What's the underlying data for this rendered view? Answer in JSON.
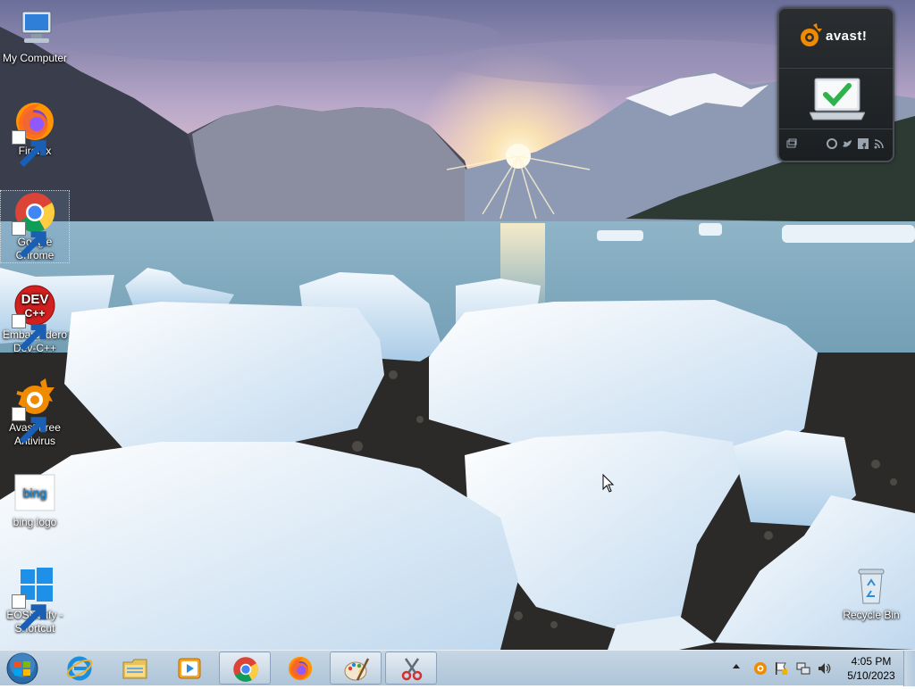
{
  "desktop": {
    "icons": [
      {
        "label": "My Computer",
        "icon": "computer-icon"
      },
      {
        "label": "Firefox",
        "icon": "firefox-icon"
      },
      {
        "label": "Google Chrome",
        "icon": "chrome-icon"
      },
      {
        "label": "Embarcadero Dev-C++",
        "icon": "devcpp-icon"
      },
      {
        "label": "Avast Free Antivirus",
        "icon": "avast-icon"
      },
      {
        "label": "bing logo",
        "icon": "bing-icon"
      },
      {
        "label": "EOSNotify - Shortcut",
        "icon": "windows-icon"
      },
      {
        "label": "Recycle Bin",
        "icon": "recycle-bin-icon"
      }
    ],
    "devcpp_badge_top": "DEV",
    "devcpp_badge_bottom": "C++",
    "bing_logo_text": "bing"
  },
  "gadget": {
    "brand": "avast!",
    "status_icon": "laptop-check-icon",
    "footer_icons": [
      "window-icon",
      "globe-icon",
      "twitter-icon",
      "facebook-icon",
      "rss-icon"
    ]
  },
  "taskbar": {
    "start_icon": "windows-start-orb",
    "items": [
      {
        "icon": "internet-explorer-icon",
        "open": false
      },
      {
        "icon": "file-explorer-icon",
        "open": false
      },
      {
        "icon": "media-player-icon",
        "open": false
      },
      {
        "icon": "chrome-icon",
        "open": true
      },
      {
        "icon": "firefox-icon",
        "open": false
      },
      {
        "icon": "paint-icon",
        "open": true
      },
      {
        "icon": "snipping-tool-icon",
        "open": true
      }
    ],
    "tray_icons": [
      "show-hidden-icons-arrow",
      "avast-tray-icon",
      "action-center-flag-icon",
      "network-icon",
      "volume-icon"
    ],
    "clock": {
      "time": "4:05 PM",
      "date": "5/10/2023"
    }
  },
  "colors": {
    "taskbar": "#b8cde0",
    "avast_orange": "#f08a00",
    "check_green": "#2db34a"
  }
}
